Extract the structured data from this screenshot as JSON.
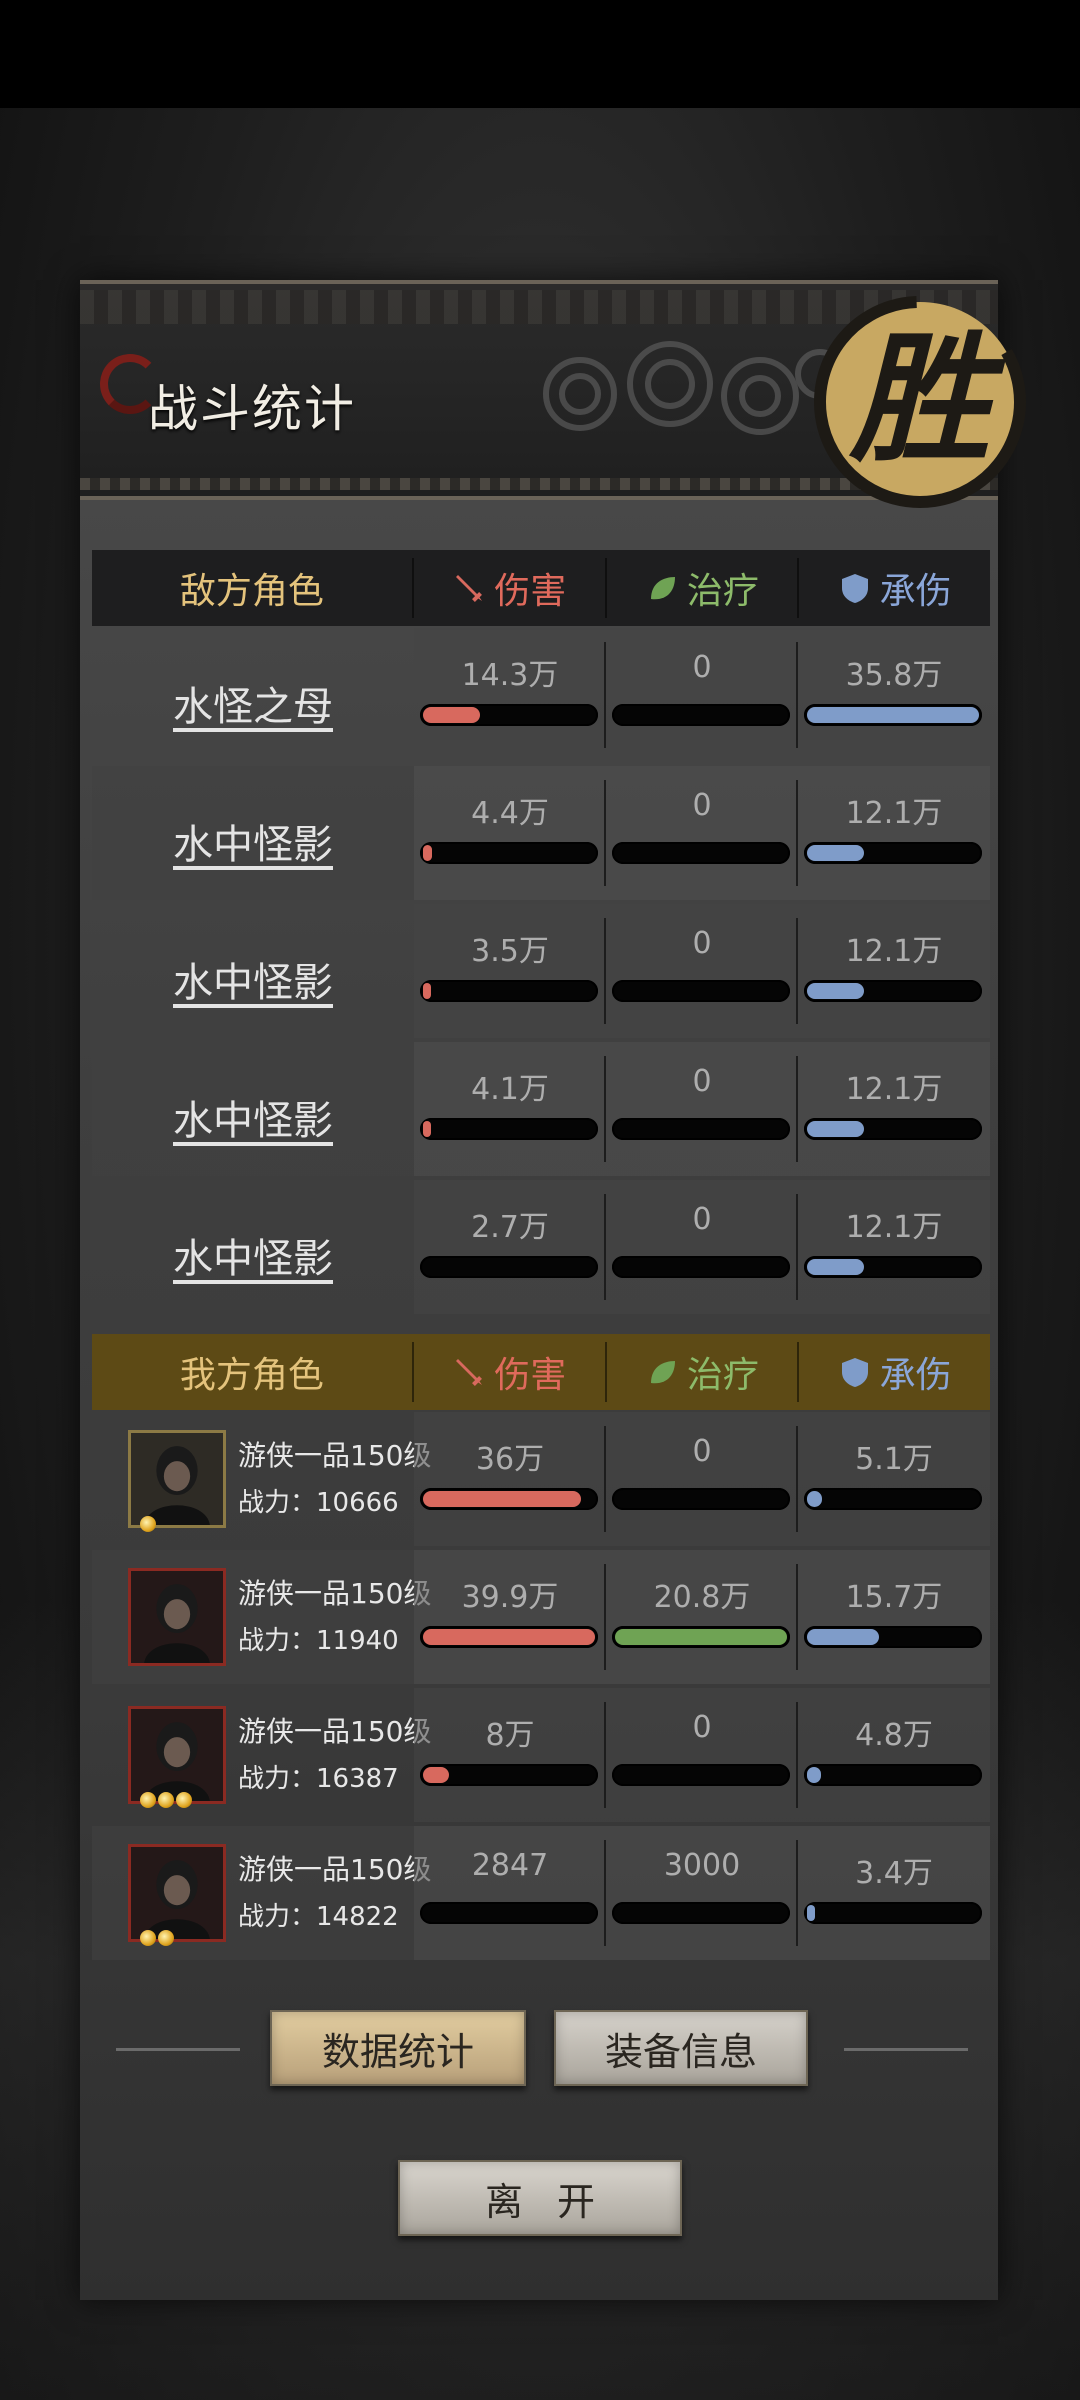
{
  "header": {
    "title": "战斗统计",
    "victory_char": "胜"
  },
  "columns": {
    "damage": "伤害",
    "heal": "治疗",
    "taken": "承伤"
  },
  "enemy": {
    "label": "敌方角色",
    "rows": [
      {
        "name": "水怪之母",
        "damage": "14.3万",
        "heal": "0",
        "taken": "35.8万",
        "damage_pct": 0.33,
        "heal_pct": 0,
        "taken_pct": 1.0
      },
      {
        "name": "水中怪影",
        "damage": "4.4万",
        "heal": "0",
        "taken": "12.1万",
        "damage_pct": 0.05,
        "heal_pct": 0,
        "taken_pct": 0.33
      },
      {
        "name": "水中怪影",
        "damage": "3.5万",
        "heal": "0",
        "taken": "12.1万",
        "damage_pct": 0.03,
        "heal_pct": 0,
        "taken_pct": 0.33
      },
      {
        "name": "水中怪影",
        "damage": "4.1万",
        "heal": "0",
        "taken": "12.1万",
        "damage_pct": 0.04,
        "heal_pct": 0,
        "taken_pct": 0.33
      },
      {
        "name": "水中怪影",
        "damage": "2.7万",
        "heal": "0",
        "taken": "12.1万",
        "damage_pct": 0,
        "heal_pct": 0,
        "taken_pct": 0.33
      }
    ]
  },
  "ally": {
    "label": "我方角色",
    "rows": [
      {
        "job": "游侠一品150级",
        "power_label": "战力：",
        "power": "10666",
        "stars": 1,
        "frame": "gold",
        "damage": "36万",
        "heal": "0",
        "taken": "5.1万",
        "damage_pct": 0.92,
        "heal_pct": 0,
        "taken_pct": 0.09
      },
      {
        "job": "游侠一品150级",
        "power_label": "战力：",
        "power": "11940",
        "stars": 0,
        "frame": "red",
        "damage": "39.9万",
        "heal": "20.8万",
        "taken": "15.7万",
        "damage_pct": 1.0,
        "heal_pct": 1.0,
        "taken_pct": 0.42
      },
      {
        "job": "游侠一品150级",
        "power_label": "战力：",
        "power": "16387",
        "stars": 3,
        "frame": "red",
        "damage": "8万",
        "heal": "0",
        "taken": "4.8万",
        "damage_pct": 0.15,
        "heal_pct": 0,
        "taken_pct": 0.08
      },
      {
        "job": "游侠一品150级",
        "power_label": "战力：",
        "power": "14822",
        "stars": 2,
        "frame": "red",
        "damage": "2847",
        "heal": "3000",
        "taken": "3.4万",
        "damage_pct": 0,
        "heal_pct": 0,
        "taken_pct": 0.02
      }
    ]
  },
  "buttons": {
    "stats": "数据统计",
    "equip": "装备信息",
    "leave": "离开"
  },
  "colors": {
    "damage": "#d8695e",
    "heal": "#6fa354",
    "taken": "#7f9cc9",
    "enemy_header": "#1e1e1f",
    "ally_header": "#5d4a15"
  }
}
